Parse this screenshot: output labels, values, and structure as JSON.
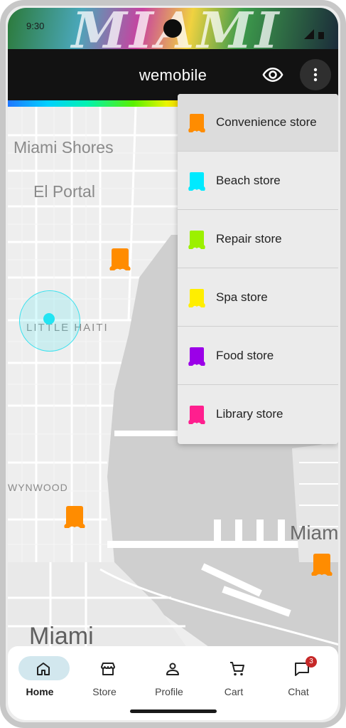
{
  "status_bar": {
    "time": "9:30"
  },
  "app_bar": {
    "title": "wemobile",
    "visibility_icon": "eye-icon",
    "more_icon": "more-vert-icon"
  },
  "map": {
    "labels": {
      "miami_shores": "Miami Shores",
      "el_portal": "El Portal",
      "little_haiti": "LITTLE HAITI",
      "wynwood": "WYNWOOD",
      "miami": "Miami",
      "miami_beach_partial": "Miam"
    }
  },
  "store_menu": {
    "items": [
      {
        "label": "Convenience store",
        "color": "#ff8c00"
      },
      {
        "label": "Beach store",
        "color": "#00eaff"
      },
      {
        "label": "Repair store",
        "color": "#9cf000"
      },
      {
        "label": "Spa store",
        "color": "#ffee00"
      },
      {
        "label": "Food store",
        "color": "#9b00e8"
      },
      {
        "label": "Library store",
        "color": "#ff1f8e"
      }
    ],
    "selected": "Convenience store"
  },
  "bottom_nav": {
    "items": [
      {
        "label": "Home",
        "icon": "home-icon",
        "active": true
      },
      {
        "label": "Store",
        "icon": "store-icon",
        "active": false
      },
      {
        "label": "Profile",
        "icon": "person-icon",
        "active": false
      },
      {
        "label": "Cart",
        "icon": "cart-icon",
        "active": false
      },
      {
        "label": "Chat",
        "icon": "chat-icon",
        "active": false
      }
    ],
    "chat_badge": "3"
  },
  "colors": {
    "app_bar": "#121212",
    "nav_active_pill": "#d2e7ee",
    "location_marker": "#22e4f2",
    "map_water": "#cfcfcf",
    "map_land": "#eeeeee"
  }
}
